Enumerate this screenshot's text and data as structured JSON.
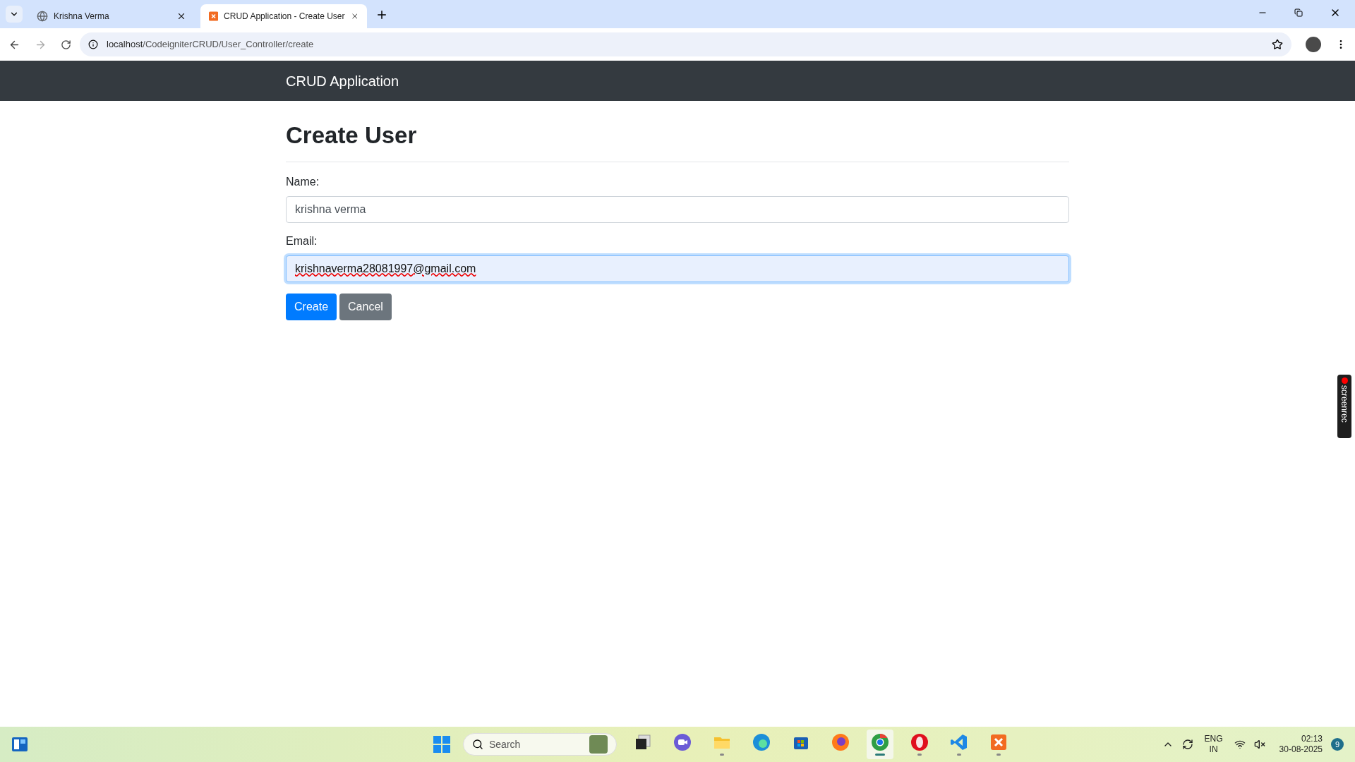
{
  "browser": {
    "tabs": [
      {
        "title": "Krishna Verma",
        "kind": "globe",
        "selected": false
      },
      {
        "title": "CRUD Application - Create User",
        "kind": "app",
        "selected": true
      }
    ],
    "address": {
      "host": "localhost",
      "path": "/CodeigniterCRUD/User_Controller/create"
    }
  },
  "navbar": {
    "brand": "CRUD Application"
  },
  "page": {
    "heading": "Create User",
    "fields": [
      {
        "label": "Name:",
        "value": "krishna verma",
        "focused": false,
        "misspelled": false
      },
      {
        "label": "Email:",
        "value": "krishnaverma28081997@gmail.com",
        "focused": true,
        "misspelled": true
      }
    ],
    "buttons": [
      {
        "label": "Create",
        "kind": "primary"
      },
      {
        "label": "Cancel",
        "kind": "secondary"
      }
    ]
  },
  "recorder": {
    "label": "screenrec"
  },
  "taskbar": {
    "search_placeholder": "Search",
    "apps": [
      {
        "kind": "taskview",
        "running": false,
        "selected": false
      },
      {
        "kind": "meet",
        "running": false,
        "selected": false
      },
      {
        "kind": "files",
        "running": true,
        "selected": false
      },
      {
        "kind": "edge",
        "running": false,
        "selected": false
      },
      {
        "kind": "store",
        "running": false,
        "selected": false
      },
      {
        "kind": "firefox",
        "running": false,
        "selected": false
      },
      {
        "kind": "chrome",
        "running": true,
        "selected": true
      },
      {
        "kind": "opera",
        "running": true,
        "selected": false
      },
      {
        "kind": "vscode",
        "running": true,
        "selected": false
      },
      {
        "kind": "xampp",
        "running": true,
        "selected": false
      }
    ],
    "language": [
      "ENG",
      "IN"
    ],
    "time": "02:13",
    "date": "30-08-2025",
    "notifications": "9"
  }
}
